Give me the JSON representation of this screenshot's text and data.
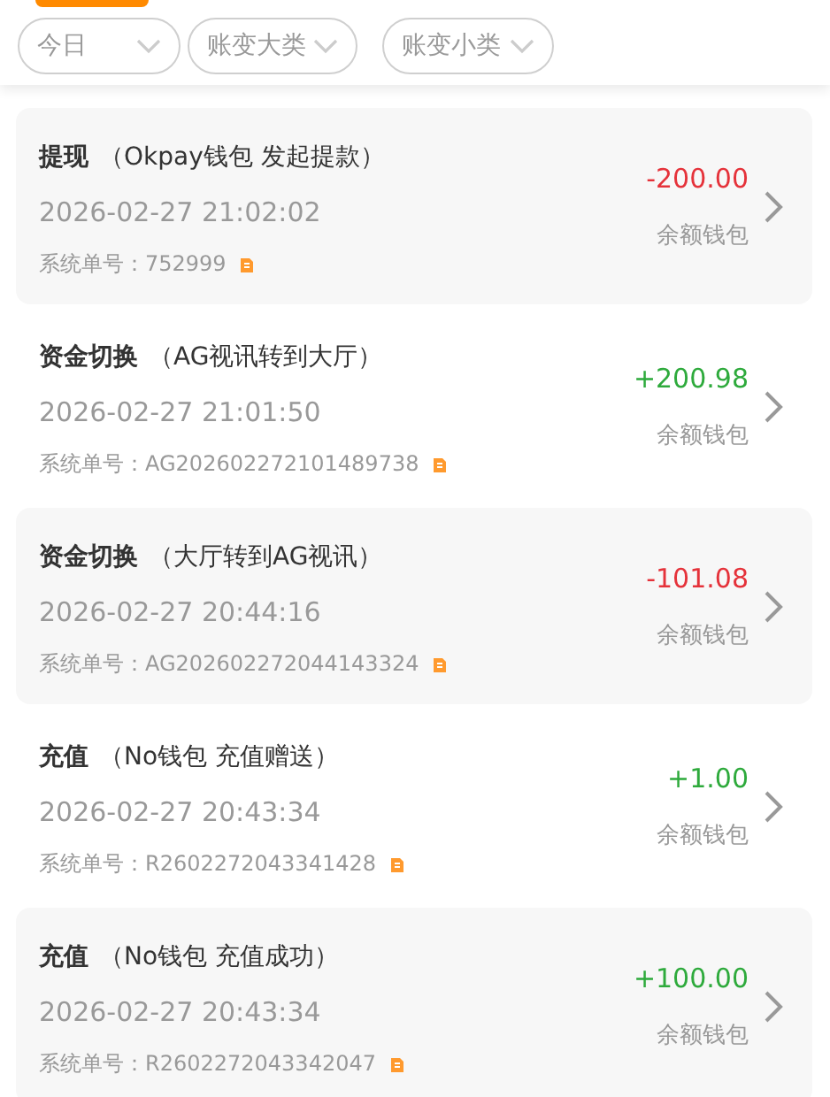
{
  "filters": [
    {
      "label": "今日"
    },
    {
      "label": "账变大类"
    },
    {
      "label": "账变小类"
    }
  ],
  "records": [
    {
      "type": "提现",
      "detail": "（Okpay钱包 发起提款）",
      "time": "2026-02-27 21:02:02",
      "order_label": "系统单号：",
      "order_no": "752999",
      "amount": "-200.00",
      "kind": "debit",
      "wallet": "余额钱包"
    },
    {
      "type": "资金切换",
      "detail": "（AG视讯转到大厅）",
      "time": "2026-02-27 21:01:50",
      "order_label": "系统单号：",
      "order_no": "AG202602272101489738",
      "amount": "+200.98",
      "kind": "credit",
      "wallet": "余额钱包"
    },
    {
      "type": "资金切换",
      "detail": "（大厅转到AG视讯）",
      "time": "2026-02-27 20:44:16",
      "order_label": "系统单号：",
      "order_no": "AG202602272044143324",
      "amount": "-101.08",
      "kind": "debit",
      "wallet": "余额钱包"
    },
    {
      "type": "充值",
      "detail": "（No钱包 充值赠送）",
      "time": "2026-02-27 20:43:34",
      "order_label": "系统单号：",
      "order_no": "R2602272043341428",
      "amount": "+1.00",
      "kind": "credit",
      "wallet": "余额钱包"
    },
    {
      "type": "充值",
      "detail": "（No钱包 充值成功）",
      "time": "2026-02-27 20:43:34",
      "order_label": "系统单号：",
      "order_no": "R2602272043342047",
      "amount": "+100.00",
      "kind": "credit",
      "wallet": "余额钱包"
    }
  ]
}
